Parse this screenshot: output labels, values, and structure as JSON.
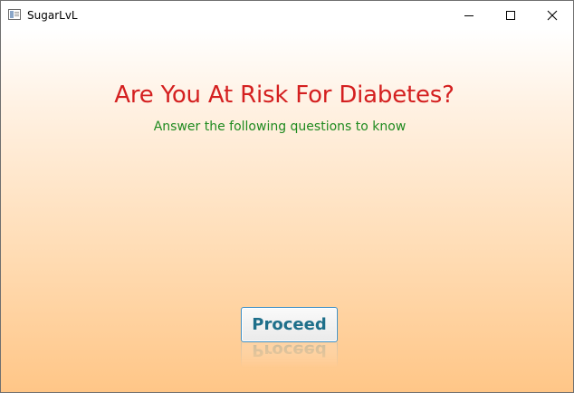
{
  "window": {
    "title": "SugarLvL",
    "controls": {
      "minimize_icon": "minimize-icon",
      "maximize_icon": "maximize-icon",
      "close_icon": "close-icon"
    }
  },
  "main": {
    "headline": "Are You At Risk For Diabetes?",
    "subtitle": "Answer the following questions to know",
    "proceed_label": "Proceed"
  },
  "colors": {
    "headline": "#d42020",
    "subtitle": "#1f8a1f",
    "button_text": "#1e6f8a",
    "button_border": "#3c8fc6",
    "gradient_top": "#ffffff",
    "gradient_bottom": "#ffc687"
  }
}
